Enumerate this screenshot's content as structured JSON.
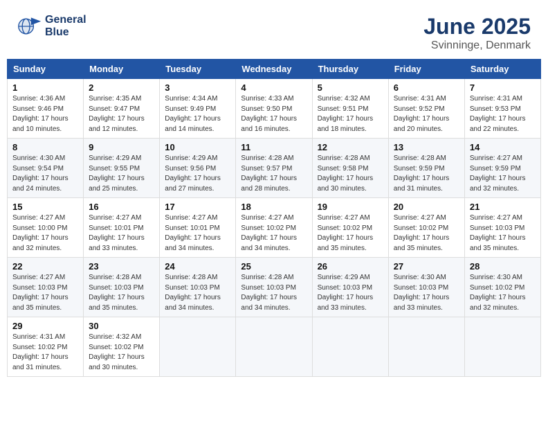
{
  "header": {
    "logo_line1": "General",
    "logo_line2": "Blue",
    "title": "June 2025",
    "subtitle": "Svinninge, Denmark"
  },
  "weekdays": [
    "Sunday",
    "Monday",
    "Tuesday",
    "Wednesday",
    "Thursday",
    "Friday",
    "Saturday"
  ],
  "weeks": [
    [
      {
        "day": "1",
        "info": "Sunrise: 4:36 AM\nSunset: 9:46 PM\nDaylight: 17 hours\nand 10 minutes."
      },
      {
        "day": "2",
        "info": "Sunrise: 4:35 AM\nSunset: 9:47 PM\nDaylight: 17 hours\nand 12 minutes."
      },
      {
        "day": "3",
        "info": "Sunrise: 4:34 AM\nSunset: 9:49 PM\nDaylight: 17 hours\nand 14 minutes."
      },
      {
        "day": "4",
        "info": "Sunrise: 4:33 AM\nSunset: 9:50 PM\nDaylight: 17 hours\nand 16 minutes."
      },
      {
        "day": "5",
        "info": "Sunrise: 4:32 AM\nSunset: 9:51 PM\nDaylight: 17 hours\nand 18 minutes."
      },
      {
        "day": "6",
        "info": "Sunrise: 4:31 AM\nSunset: 9:52 PM\nDaylight: 17 hours\nand 20 minutes."
      },
      {
        "day": "7",
        "info": "Sunrise: 4:31 AM\nSunset: 9:53 PM\nDaylight: 17 hours\nand 22 minutes."
      }
    ],
    [
      {
        "day": "8",
        "info": "Sunrise: 4:30 AM\nSunset: 9:54 PM\nDaylight: 17 hours\nand 24 minutes."
      },
      {
        "day": "9",
        "info": "Sunrise: 4:29 AM\nSunset: 9:55 PM\nDaylight: 17 hours\nand 25 minutes."
      },
      {
        "day": "10",
        "info": "Sunrise: 4:29 AM\nSunset: 9:56 PM\nDaylight: 17 hours\nand 27 minutes."
      },
      {
        "day": "11",
        "info": "Sunrise: 4:28 AM\nSunset: 9:57 PM\nDaylight: 17 hours\nand 28 minutes."
      },
      {
        "day": "12",
        "info": "Sunrise: 4:28 AM\nSunset: 9:58 PM\nDaylight: 17 hours\nand 30 minutes."
      },
      {
        "day": "13",
        "info": "Sunrise: 4:28 AM\nSunset: 9:59 PM\nDaylight: 17 hours\nand 31 minutes."
      },
      {
        "day": "14",
        "info": "Sunrise: 4:27 AM\nSunset: 9:59 PM\nDaylight: 17 hours\nand 32 minutes."
      }
    ],
    [
      {
        "day": "15",
        "info": "Sunrise: 4:27 AM\nSunset: 10:00 PM\nDaylight: 17 hours\nand 32 minutes."
      },
      {
        "day": "16",
        "info": "Sunrise: 4:27 AM\nSunset: 10:01 PM\nDaylight: 17 hours\nand 33 minutes."
      },
      {
        "day": "17",
        "info": "Sunrise: 4:27 AM\nSunset: 10:01 PM\nDaylight: 17 hours\nand 34 minutes."
      },
      {
        "day": "18",
        "info": "Sunrise: 4:27 AM\nSunset: 10:02 PM\nDaylight: 17 hours\nand 34 minutes."
      },
      {
        "day": "19",
        "info": "Sunrise: 4:27 AM\nSunset: 10:02 PM\nDaylight: 17 hours\nand 35 minutes."
      },
      {
        "day": "20",
        "info": "Sunrise: 4:27 AM\nSunset: 10:02 PM\nDaylight: 17 hours\nand 35 minutes."
      },
      {
        "day": "21",
        "info": "Sunrise: 4:27 AM\nSunset: 10:03 PM\nDaylight: 17 hours\nand 35 minutes."
      }
    ],
    [
      {
        "day": "22",
        "info": "Sunrise: 4:27 AM\nSunset: 10:03 PM\nDaylight: 17 hours\nand 35 minutes."
      },
      {
        "day": "23",
        "info": "Sunrise: 4:28 AM\nSunset: 10:03 PM\nDaylight: 17 hours\nand 35 minutes."
      },
      {
        "day": "24",
        "info": "Sunrise: 4:28 AM\nSunset: 10:03 PM\nDaylight: 17 hours\nand 34 minutes."
      },
      {
        "day": "25",
        "info": "Sunrise: 4:28 AM\nSunset: 10:03 PM\nDaylight: 17 hours\nand 34 minutes."
      },
      {
        "day": "26",
        "info": "Sunrise: 4:29 AM\nSunset: 10:03 PM\nDaylight: 17 hours\nand 33 minutes."
      },
      {
        "day": "27",
        "info": "Sunrise: 4:30 AM\nSunset: 10:03 PM\nDaylight: 17 hours\nand 33 minutes."
      },
      {
        "day": "28",
        "info": "Sunrise: 4:30 AM\nSunset: 10:02 PM\nDaylight: 17 hours\nand 32 minutes."
      }
    ],
    [
      {
        "day": "29",
        "info": "Sunrise: 4:31 AM\nSunset: 10:02 PM\nDaylight: 17 hours\nand 31 minutes."
      },
      {
        "day": "30",
        "info": "Sunrise: 4:32 AM\nSunset: 10:02 PM\nDaylight: 17 hours\nand 30 minutes."
      },
      null,
      null,
      null,
      null,
      null
    ]
  ]
}
